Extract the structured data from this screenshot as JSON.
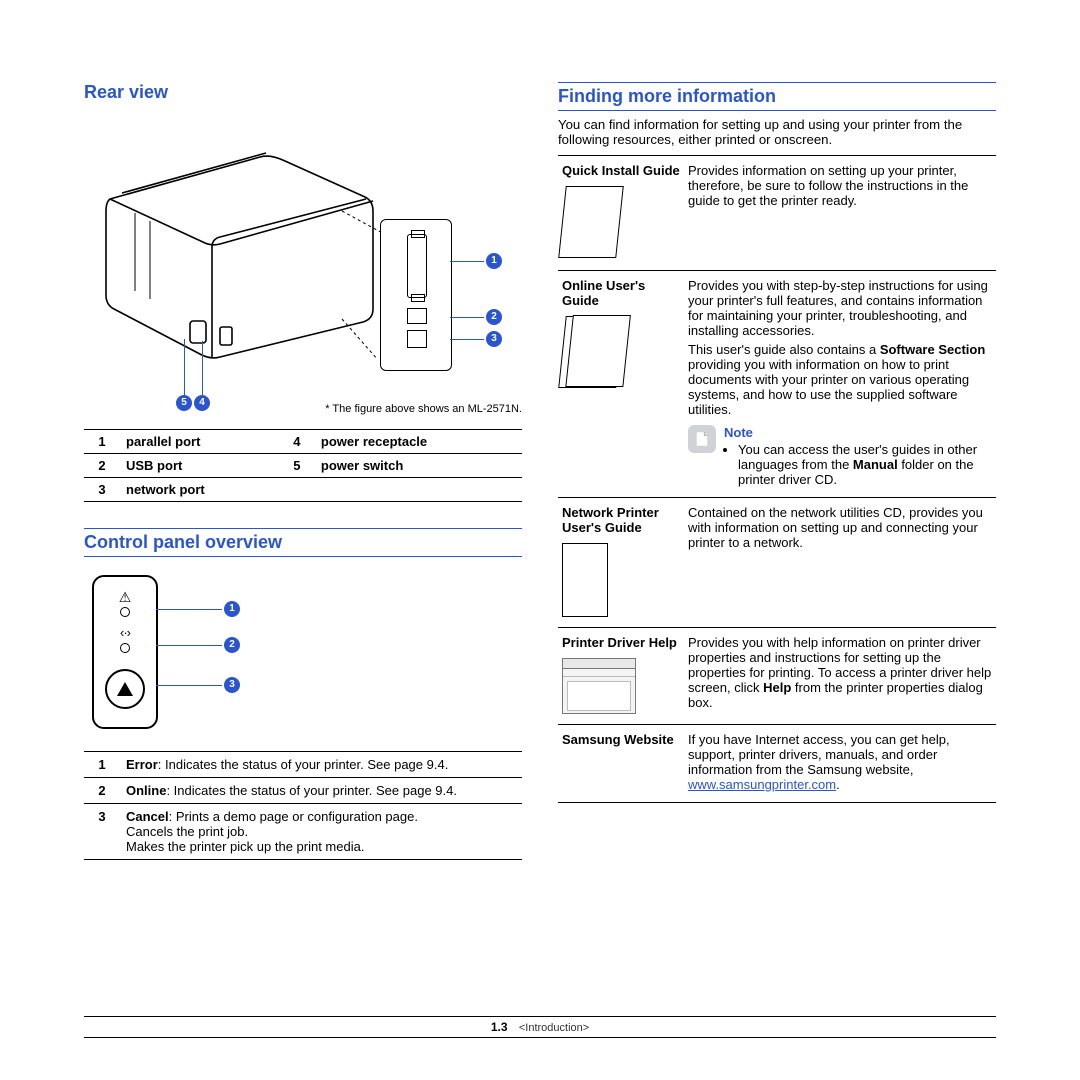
{
  "left": {
    "rear_heading": "Rear view",
    "caption_prefix": "* The figure above shows an ",
    "caption_model": "ML-2571N.",
    "callouts": {
      "c1": "1",
      "c2": "2",
      "c3": "3",
      "c4": "4",
      "c5": "5"
    },
    "parts": [
      {
        "n": "1",
        "name": "parallel port"
      },
      {
        "n": "2",
        "name": "USB port"
      },
      {
        "n": "3",
        "name": "network port"
      },
      {
        "n": "4",
        "name": "power receptacle"
      },
      {
        "n": "5",
        "name": "power switch"
      }
    ],
    "cp_heading": "Control panel overview",
    "cp_callouts": {
      "c1": "1",
      "c2": "2",
      "c3": "3"
    },
    "cp_rows": [
      {
        "n": "1",
        "b": "Error",
        "rest": ": Indicates the status of your printer. See page 9.4."
      },
      {
        "n": "2",
        "b": "Online",
        "rest": ": Indicates the status of your printer. See page 9.4."
      },
      {
        "n": "3",
        "b": "Cancel",
        "rest": ": Prints a demo page or configuration page.",
        "extra1": "Cancels the print job.",
        "extra2": "Makes the printer pick up the print media."
      }
    ]
  },
  "right": {
    "heading": "Finding more information",
    "intro": "You can find information for setting up and using your printer from the following resources, either printed or onscreen.",
    "rows": [
      {
        "title": "Quick Install Guide",
        "body": "Provides information on setting up your printer, therefore, be sure to follow the instructions in the guide to get the printer ready."
      },
      {
        "title": "Online User's Guide",
        "body1": "Provides you with step-by-step instructions for using your printer's full features, and contains information for maintaining your printer, troubleshooting, and installing accessories.",
        "body2a": "This user's guide also contains a ",
        "body2b": "Software Section",
        "body2c": " providing you with information on how to print documents with your printer on various operating systems, and how to use the supplied software utilities.",
        "note_label": "Note",
        "note_a": "You can access the user's guides in other languages from the ",
        "note_b": "Manual",
        "note_c": " folder on the printer driver CD."
      },
      {
        "title": "Network Printer User's Guide",
        "body": "Contained on the network utilities CD, provides you with information on setting up and connecting your printer to a network."
      },
      {
        "title": "Printer Driver Help",
        "body_a": "Provides you with help information on printer driver properties and instructions for setting up the properties for printing. To access a printer driver help screen, click ",
        "body_b": "Help",
        "body_c": " from the printer properties dialog box."
      },
      {
        "title": "Samsung Website",
        "body": "If you have Internet access, you can get help, support, printer drivers, manuals, and order information from the Samsung website, ",
        "url": "www.samsungprinter.com",
        "tail": "."
      }
    ]
  },
  "footer": {
    "page": "1.3",
    "chapter": "<Introduction>"
  }
}
